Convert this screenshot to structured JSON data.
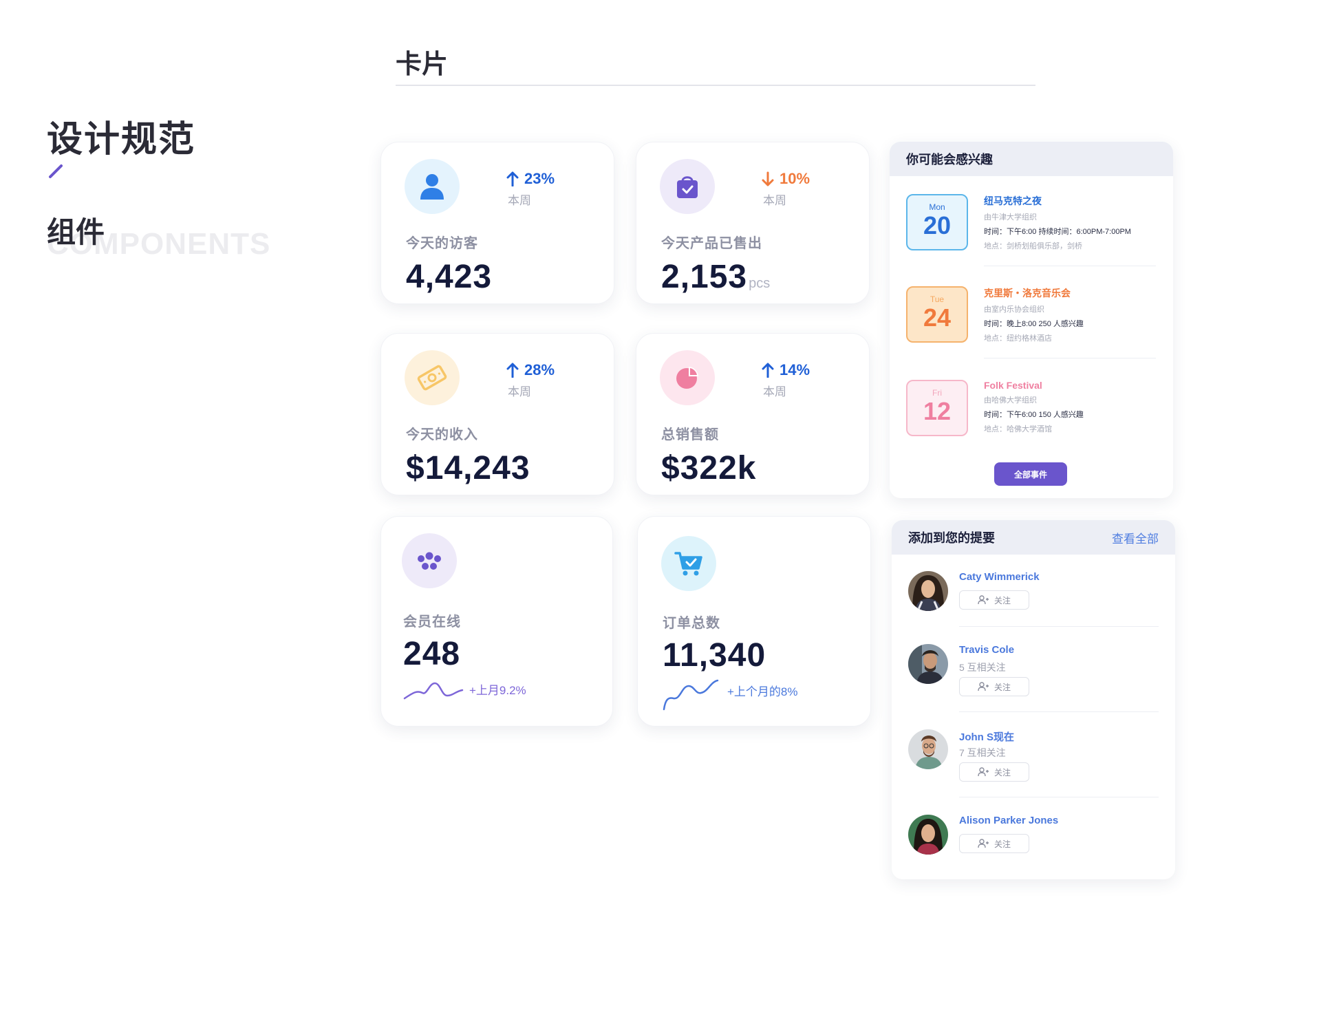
{
  "left": {
    "title": "设计规范",
    "subtitle": "组件",
    "subtitle_ghost": "COMPONENTS",
    "accent": "#6a55cc"
  },
  "section": {
    "title": "卡片"
  },
  "stats": {
    "visitors": {
      "icon": "user-icon",
      "trend_dir": "up",
      "trend": "23%",
      "period": "本周",
      "label": "今天的访客",
      "value": "4,423",
      "color": "#1f5fd6"
    },
    "sold": {
      "icon": "shopping-bag-icon",
      "trend_dir": "down",
      "trend": "10%",
      "period": "本周",
      "label": "今天产品已售出",
      "value": "2,153",
      "unit": "pcs",
      "color": "#f07a3c"
    },
    "income": {
      "icon": "money-icon",
      "trend_dir": "up",
      "trend": "28%",
      "period": "本周",
      "label": "今天的收入",
      "value": "$14,243",
      "color": "#1f5fd6"
    },
    "sales": {
      "icon": "pie-chart-icon",
      "trend_dir": "up",
      "trend": "14%",
      "period": "本周",
      "label": "总销售额",
      "value": "$322k",
      "color": "#1f5fd6"
    },
    "members": {
      "icon": "group-icon",
      "label": "会员在线",
      "value": "248",
      "spark_text": "+上月9.2%",
      "color": "#7d66d8"
    },
    "orders": {
      "icon": "cart-icon",
      "label": "订单总数",
      "value": "11,340",
      "spark_text": "+上个月的8%",
      "color": "#4a78dc"
    }
  },
  "interests": {
    "title": "你可能会感兴趣",
    "button": "全部事件",
    "events": [
      {
        "dow": "Mon",
        "day": "20",
        "title": "纽马克特之夜",
        "org": "由牛津大学组织",
        "time": "时间：下午6:00  持续时间：6:00PM-7:00PM",
        "place": "地点：剑桥划船俱乐部，剑桥",
        "color": "#2a6fd6"
      },
      {
        "dow": "Tue",
        "day": "24",
        "title": "克里斯・洛克音乐会",
        "org": "由室内乐协会组织",
        "time": "时间：晚上8:00  250 人感兴趣",
        "place": "地点：纽约格林酒店",
        "color": "#f07a3c"
      },
      {
        "dow": "Fri",
        "day": "12",
        "title": "Folk Festival",
        "org": "由哈佛大学组织",
        "time": "时间：下午6:00  150 人感兴趣",
        "place": "地点：哈佛大学酒馆",
        "color": "#ef7fa0"
      }
    ]
  },
  "summary": {
    "title": "添加到您的提要",
    "view_all": "查看全部",
    "follow_label": "关注",
    "people": [
      {
        "name": "Caty Wimmerick",
        "mutual": ""
      },
      {
        "name": "Travis Cole",
        "mutual": "5 互相关注"
      },
      {
        "name": "John S现在",
        "mutual": "7 互相关注"
      },
      {
        "name": "Alison Parker Jones",
        "mutual": ""
      }
    ]
  }
}
